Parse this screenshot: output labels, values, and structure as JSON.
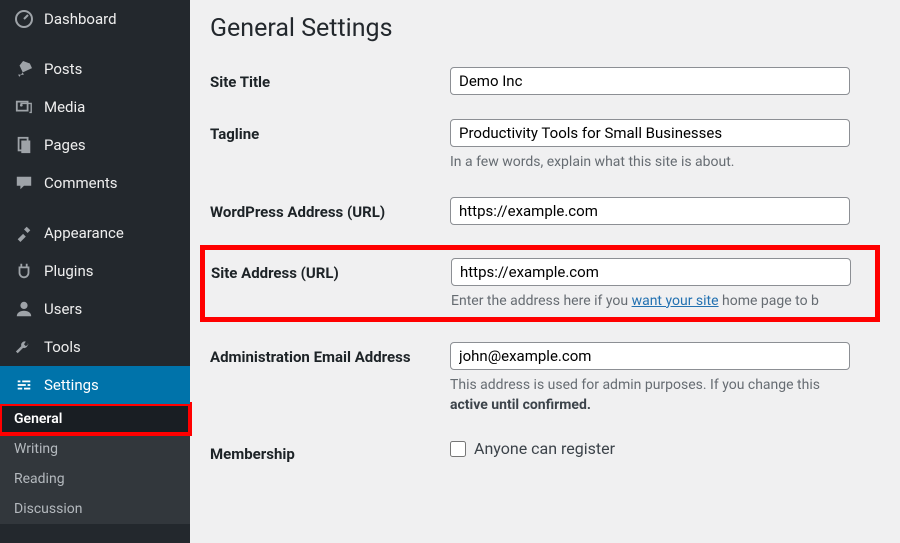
{
  "sidebar": {
    "items": [
      {
        "label": "Dashboard",
        "icon": "dashboard"
      },
      {
        "label": "Posts",
        "icon": "pin"
      },
      {
        "label": "Media",
        "icon": "media"
      },
      {
        "label": "Pages",
        "icon": "pages"
      },
      {
        "label": "Comments",
        "icon": "comments"
      },
      {
        "label": "Appearance",
        "icon": "appearance"
      },
      {
        "label": "Plugins",
        "icon": "plugins"
      },
      {
        "label": "Users",
        "icon": "users"
      },
      {
        "label": "Tools",
        "icon": "tools"
      },
      {
        "label": "Settings",
        "icon": "settings",
        "active": true
      }
    ],
    "submenu": [
      {
        "label": "General",
        "current": true
      },
      {
        "label": "Writing"
      },
      {
        "label": "Reading"
      },
      {
        "label": "Discussion"
      }
    ]
  },
  "page": {
    "title": "General Settings",
    "site_title_label": "Site Title",
    "site_title_value": "Demo Inc",
    "tagline_label": "Tagline",
    "tagline_value": "Productivity Tools for Small Businesses",
    "tagline_desc": "In a few words, explain what this site is about.",
    "wp_url_label": "WordPress Address (URL)",
    "wp_url_value": "https://example.com",
    "site_url_label": "Site Address (URL)",
    "site_url_value": "https://example.com",
    "site_url_desc1": "Enter the address here if you ",
    "site_url_link": "want your site",
    "site_url_desc2": " home page to b",
    "admin_email_label": "Administration Email Address",
    "admin_email_value": "john@example.com",
    "admin_email_desc1": "This address is used for admin purposes. If you change this",
    "admin_email_strong": "active until confirmed.",
    "membership_label": "Membership",
    "membership_checkbox_label": "Anyone can register"
  }
}
